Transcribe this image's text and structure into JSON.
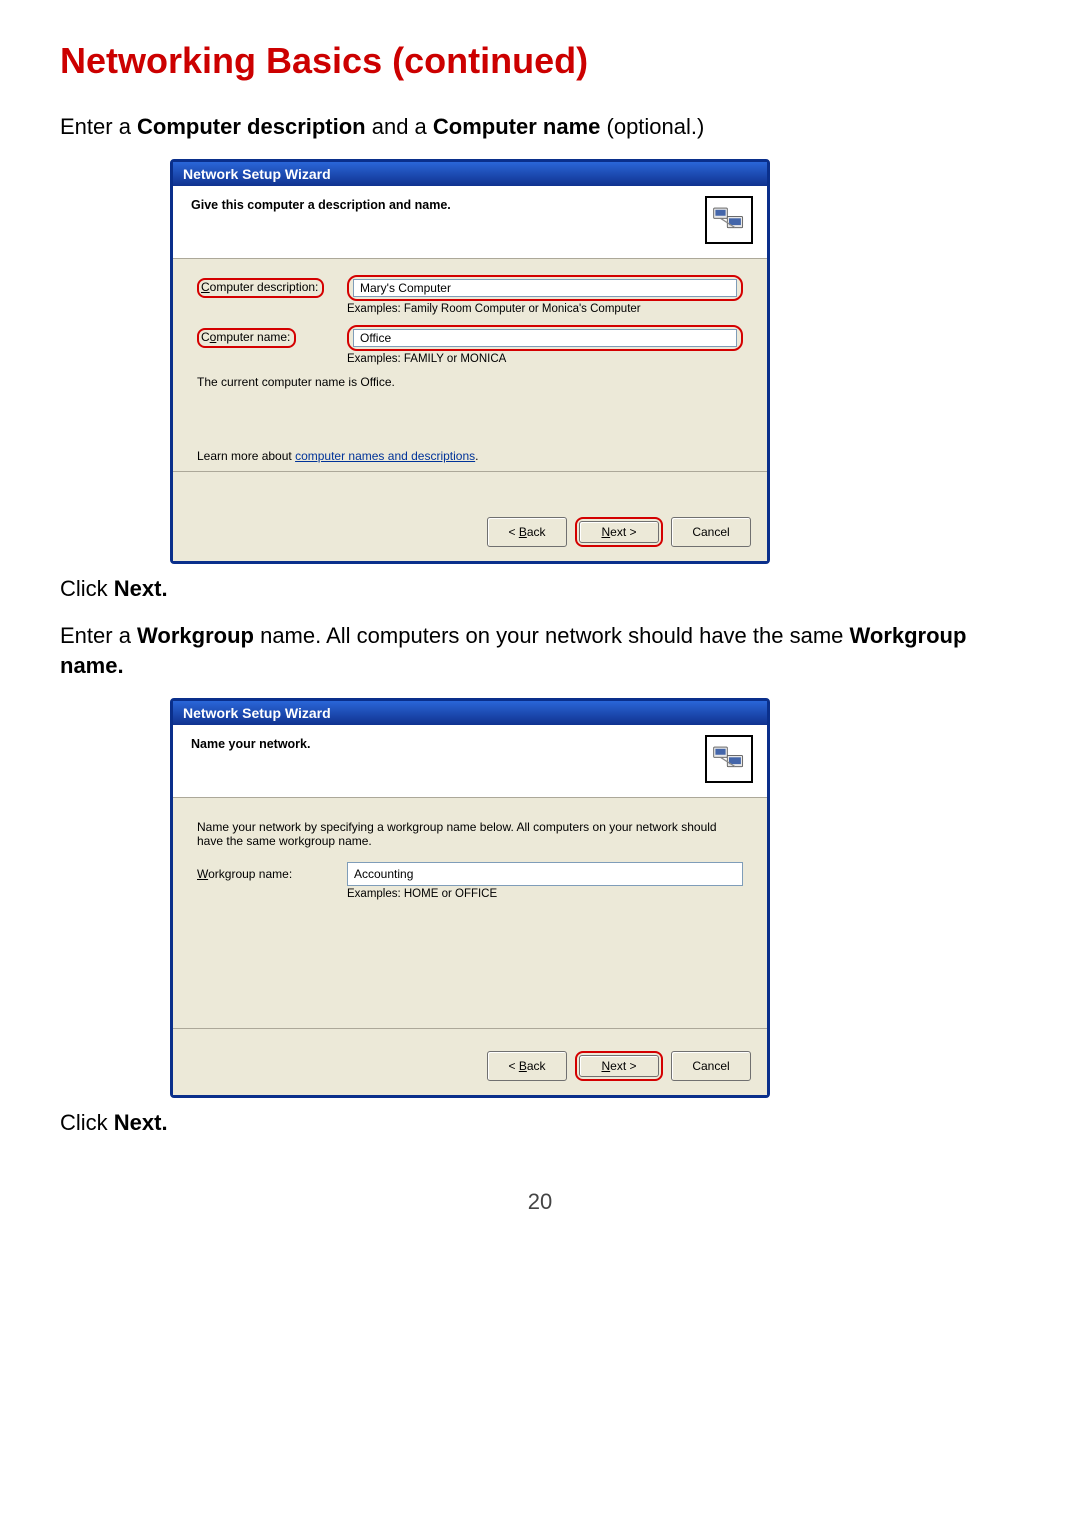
{
  "page": {
    "heading": "Networking Basics (continued)",
    "intro_prefix": "Enter a ",
    "intro_bold1": "Computer description",
    "intro_mid": " and a ",
    "intro_bold2": "Computer name",
    "intro_suffix": " (optional.)",
    "click_next": "Click ",
    "click_next_bold": "Next.",
    "wg_intro_prefix": "Enter a ",
    "wg_intro_bold1": "Workgroup",
    "wg_intro_mid": " name. All computers on your network should have the same ",
    "wg_intro_bold2": "Workgroup name.",
    "pagenum": "20"
  },
  "wiz1": {
    "title": "Network Setup Wizard",
    "heading": "Give this computer a description and name.",
    "desc_label_pre": "C",
    "desc_label_rest": "omputer description:",
    "desc_value": "Mary's Computer",
    "desc_example": "Examples: Family Room Computer or Monica's Computer",
    "name_label_pre": "C",
    "name_label_u": "o",
    "name_label_rest": "mputer name:",
    "name_value": "Office",
    "name_example": "Examples: FAMILY or MONICA",
    "current": "The current computer name is Office.",
    "learn_pre": "Learn more about ",
    "learn_link": "computer names and descriptions",
    "learn_post": ".",
    "back_pre": "< ",
    "back_u": "B",
    "back_rest": "ack",
    "next_u": "N",
    "next_rest": "ext >",
    "cancel": "Cancel"
  },
  "wiz2": {
    "title": "Network Setup Wizard",
    "heading": "Name your network.",
    "desc": "Name your network by specifying a workgroup name below. All computers on your network should have the same workgroup name.",
    "wg_label_u": "W",
    "wg_label_rest": "orkgroup name:",
    "wg_value": "Accounting",
    "wg_example": "Examples: HOME or OFFICE",
    "back_pre": "< ",
    "back_u": "B",
    "back_rest": "ack",
    "next_u": "N",
    "next_rest": "ext >",
    "cancel": "Cancel"
  }
}
